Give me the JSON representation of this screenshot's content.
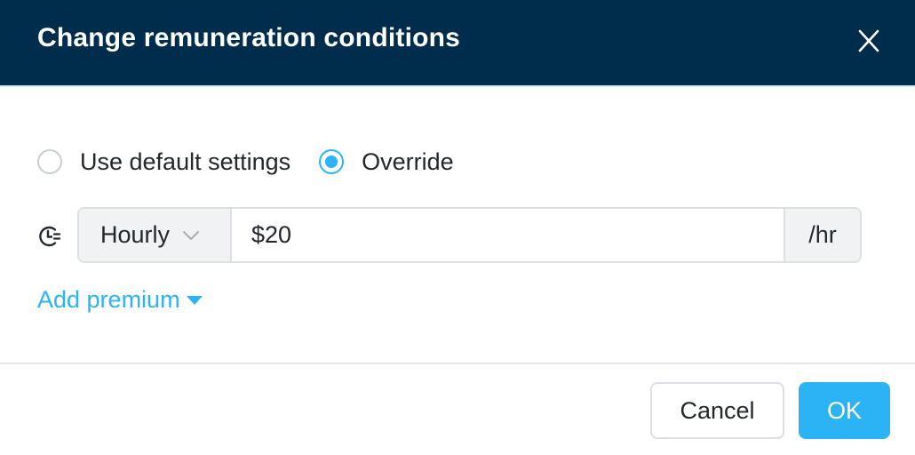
{
  "dialog": {
    "title": "Change remuneration conditions",
    "close_icon": "close-icon"
  },
  "colors": {
    "header_bg": "#002d4c",
    "accent": "#2bb3f5",
    "text": "#22272b",
    "border": "#dcdfe3",
    "addon_bg": "#f1f2f4"
  },
  "settings_mode": {
    "options": [
      {
        "label": "Use default settings",
        "selected": false
      },
      {
        "label": "Override",
        "selected": true
      }
    ]
  },
  "rate": {
    "icon": "clock-icon",
    "type_label": "Hourly",
    "type_icon": "chevron-down-icon",
    "amount_value": "$20",
    "unit": "/hr"
  },
  "premium": {
    "label": "Add premium",
    "icon": "caret-down-icon"
  },
  "footer": {
    "cancel_label": "Cancel",
    "ok_label": "OK"
  }
}
